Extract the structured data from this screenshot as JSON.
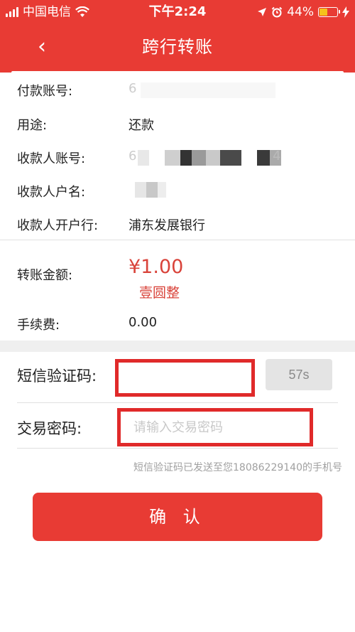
{
  "status": {
    "carrier": "中国电信",
    "time": "下午2:24",
    "battery": "44%",
    "battery_level": 0.44
  },
  "nav": {
    "back_icon": "‹",
    "title": "跨行转账"
  },
  "details": {
    "payer_label": "付款账号:",
    "payer_value": "6",
    "purpose_label": "用途:",
    "purpose_value": "还款",
    "payee_account_label": "收款人账号:",
    "payee_account_value_start": "6",
    "payee_account_value_end": "4",
    "payee_name_label": "收款人户名:",
    "payee_bank_label": "收款人开户行:",
    "payee_bank_value": "浦东发展银行"
  },
  "amount": {
    "label": "转账金额:",
    "value": "¥1.00",
    "value_cn": "壹圆整",
    "fee_label": "手续费:",
    "fee_value": "0.00"
  },
  "form": {
    "sms_label": "短信验证码:",
    "sms_value": "",
    "countdown": "57s",
    "password_label": "交易密码:",
    "password_placeholder": "请输入交易密码",
    "hint": "短信验证码已发送至您18086229140的手机号"
  },
  "confirm_label": "确 认",
  "colors": {
    "brand": "#e83b34",
    "amount": "#d9433a",
    "highlight": "#e02a2a"
  }
}
